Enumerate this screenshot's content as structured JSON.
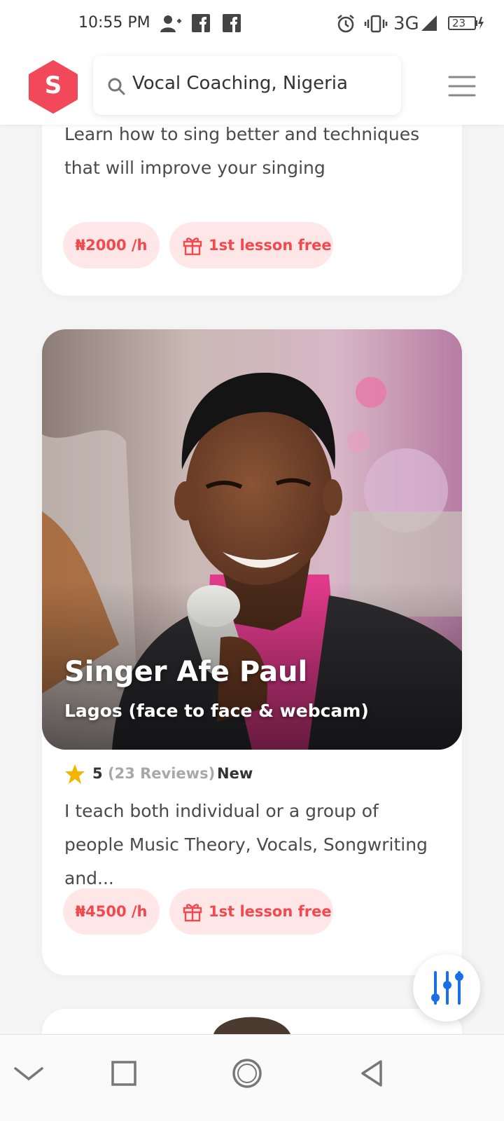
{
  "status_bar": {
    "time": "10:55 PM",
    "network": "3G",
    "battery": "23",
    "icons": [
      "add-person-icon",
      "facebook-icon",
      "facebook-icon",
      "alarm-icon",
      "vibrate-icon",
      "signal-icon",
      "battery-charging-icon"
    ]
  },
  "header": {
    "logo_letter": "S",
    "search_text": "Vocal Coaching, Nigeria",
    "brand_color": "#f2495a"
  },
  "listings": [
    {
      "description": "Learn how to sing better and techniques that will improve your singing",
      "price": "₦2000 /h",
      "offer": "1st lesson free"
    },
    {
      "name": "Singer Afe Paul",
      "location": "Lagos (face to face & webcam)",
      "rating": "5",
      "reviews": "(23 Reviews)",
      "badge": "New",
      "description": "I teach both individual or a group of people Music Theory, Vocals, Songwriting and...",
      "price": "₦4500 /h",
      "offer": "1st lesson free"
    }
  ],
  "colors": {
    "pill_bg": "#ffe7e7",
    "pill_text": "#f2494f",
    "star": "#f5b400",
    "fab_icon": "#1a6fe8"
  }
}
